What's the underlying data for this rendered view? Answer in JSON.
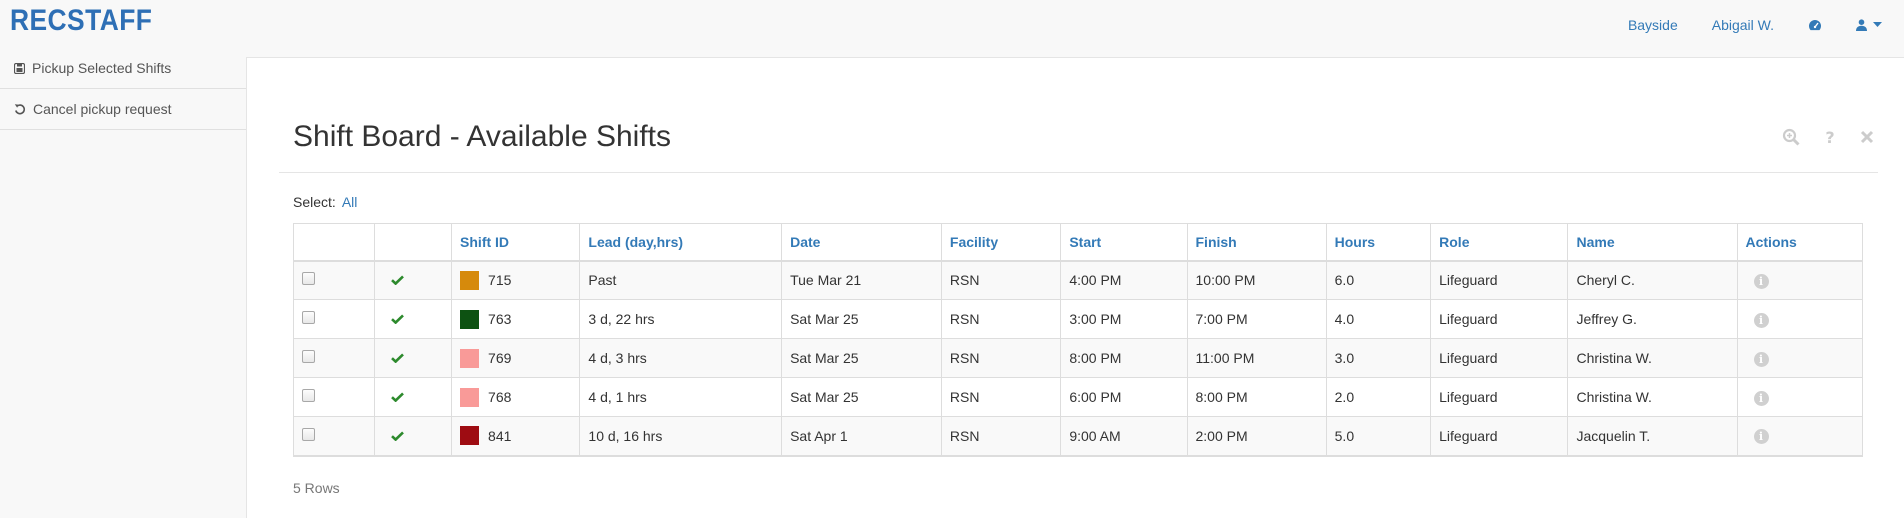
{
  "brand": "RECSTAFF",
  "nav": {
    "location": "Bayside",
    "user": "Abigail W.",
    "dashboard_icon": "dashboard-icon",
    "user_menu_icon": "user-icon"
  },
  "sidebar": {
    "items": [
      {
        "label": "Pickup Selected Shifts",
        "icon": "pickup-icon"
      },
      {
        "label": "Cancel pickup request",
        "icon": "undo-icon"
      }
    ]
  },
  "page": {
    "title": "Shift Board - Available Shifts",
    "tools": [
      "zoom-icon",
      "help-icon",
      "close-icon"
    ]
  },
  "select": {
    "label": "Select:",
    "all_link": "All"
  },
  "table": {
    "columns": [
      "Shift ID",
      "Lead (day,hrs)",
      "Date",
      "Facility",
      "Start",
      "Finish",
      "Hours",
      "Role",
      "Name",
      "Actions"
    ],
    "rows": [
      {
        "color": "#d68a0c",
        "shift_id": "715",
        "lead": "Past",
        "date": "Tue Mar 21",
        "facility": "RSN",
        "start": "4:00 PM",
        "finish": "10:00 PM",
        "hours": "6.0",
        "role": "Lifeguard",
        "name": "Cheryl C."
      },
      {
        "color": "#0d5212",
        "shift_id": "763",
        "lead": "3 d, 22 hrs",
        "date": "Sat Mar 25",
        "facility": "RSN",
        "start": "3:00 PM",
        "finish": "7:00 PM",
        "hours": "4.0",
        "role": "Lifeguard",
        "name": "Jeffrey G."
      },
      {
        "color": "#f99a98",
        "shift_id": "769",
        "lead": "4 d, 3 hrs",
        "date": "Sat Mar 25",
        "facility": "RSN",
        "start": "8:00 PM",
        "finish": "11:00 PM",
        "hours": "3.0",
        "role": "Lifeguard",
        "name": "Christina W."
      },
      {
        "color": "#f99a98",
        "shift_id": "768",
        "lead": "4 d, 1 hrs",
        "date": "Sat Mar 25",
        "facility": "RSN",
        "start": "6:00 PM",
        "finish": "8:00 PM",
        "hours": "2.0",
        "role": "Lifeguard",
        "name": "Christina W."
      },
      {
        "color": "#9e0c12",
        "shift_id": "841",
        "lead": "10 d, 16 hrs",
        "date": "Sat Apr 1",
        "facility": "RSN",
        "start": "9:00 AM",
        "finish": "2:00 PM",
        "hours": "5.0",
        "role": "Lifeguard",
        "name": "Jacquelin T."
      }
    ],
    "row_count": "5 Rows"
  },
  "colors": {
    "accent": "#337ab7",
    "check": "#2d8a2d"
  }
}
